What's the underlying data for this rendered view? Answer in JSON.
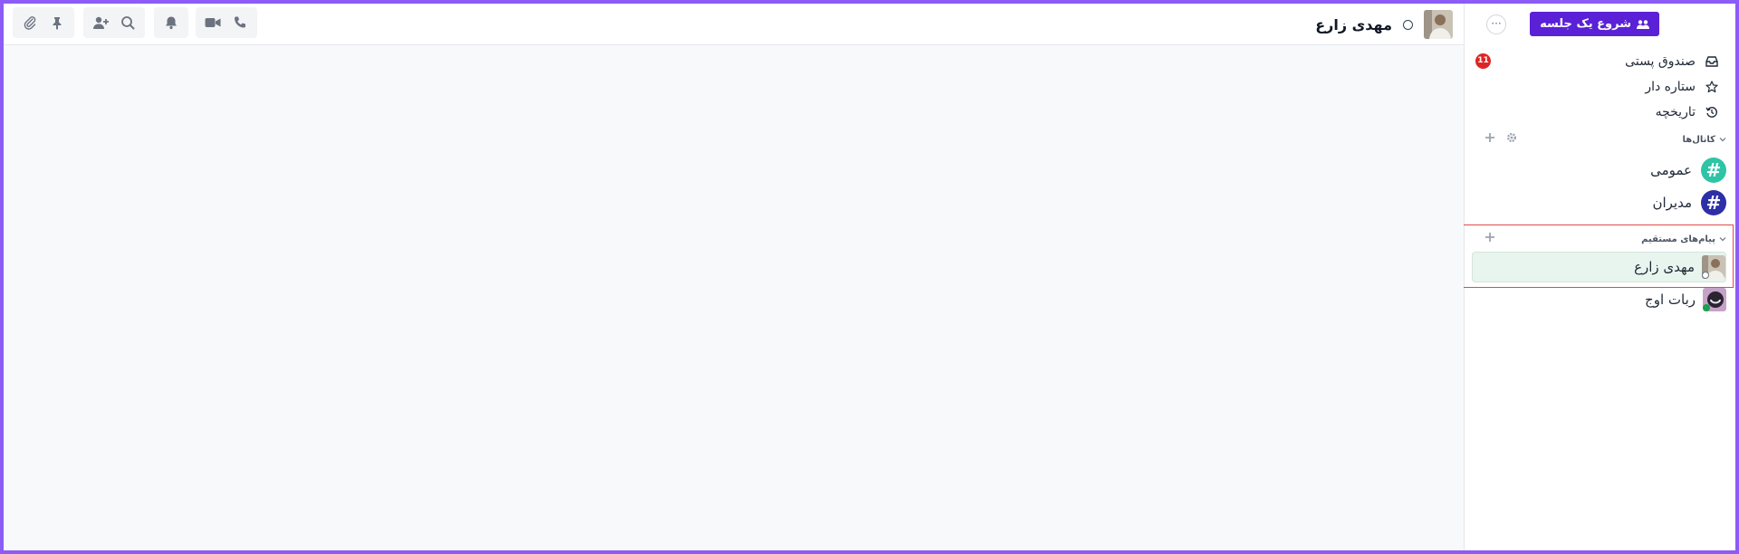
{
  "sidebar": {
    "start_session_label": "شروع یک جلسه",
    "more_label": "···",
    "nav": [
      {
        "label": "صندوق پستی",
        "icon": "inbox-icon",
        "badge": "11"
      },
      {
        "label": "ستاره دار",
        "icon": "star-icon"
      },
      {
        "label": "تاریخچه",
        "icon": "history-icon"
      }
    ],
    "channels_heading": "کانال‌ها",
    "channels": [
      {
        "label": "عمومی",
        "color": "#2ec4a6"
      },
      {
        "label": "مدیران",
        "color": "#2d2fa6"
      }
    ],
    "dms_heading": "پیام‌های مستقیم",
    "dms": [
      {
        "label": "مهدی زارع",
        "presence": "offline",
        "active": true
      },
      {
        "label": "ربات اوج",
        "presence": "online",
        "active": false
      }
    ]
  },
  "header": {
    "title": "مهدی زارع"
  },
  "colors": {
    "accent": "#5b21d6",
    "badge": "#dc2626",
    "active_row": "#e8f5ee",
    "highlight_border": "#e24a4a",
    "frame": "#8b5cf6"
  }
}
